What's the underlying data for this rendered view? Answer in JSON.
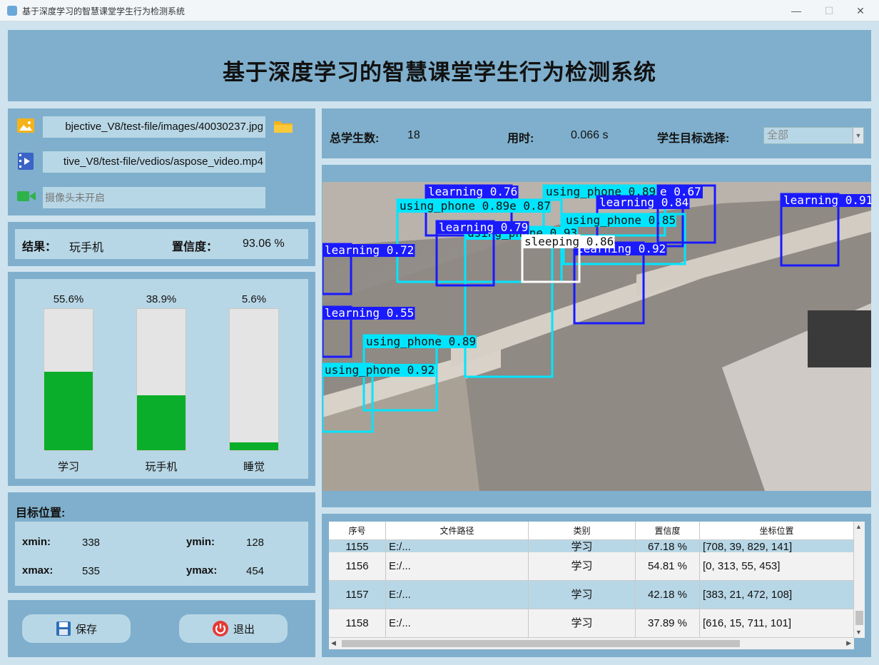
{
  "window": {
    "title": "基于深度学习的智慧课堂学生行为检测系统",
    "minimize": "—",
    "maximize": "☐",
    "close": "✕"
  },
  "header": {
    "title": "基于深度学习的智慧课堂学生行为检测系统"
  },
  "inputs": {
    "image_path": "bjective_V8/test-file/images/40030237.jpg",
    "video_path": "tive_V8/test-file/vedios/aspose_video.mp4",
    "camera_placeholder": "摄像头未开启"
  },
  "result": {
    "result_label": "结果：",
    "result_value": "玩手机",
    "confidence_label": "置信度：",
    "confidence_value": "93.06 %"
  },
  "stats": {
    "total_label": "总学生数:",
    "total_value": "18",
    "time_label": "用时:",
    "time_value": "0.066 s",
    "target_label": "学生目标选择:",
    "target_value": "全部"
  },
  "chart_data": {
    "type": "bar",
    "categories": [
      "学习",
      "玩手机",
      "睡觉"
    ],
    "values": [
      55.6,
      38.9,
      5.6
    ],
    "value_labels": [
      "55.6%",
      "38.9%",
      "5.6%"
    ],
    "ylim": [
      0,
      100
    ],
    "colors": {
      "fill": "#0aae2a",
      "track": "#e4e4e4"
    }
  },
  "position": {
    "title": "目标位置:",
    "xmin_label": "xmin:",
    "xmin": "338",
    "ymin_label": "ymin:",
    "ymin": "128",
    "xmax_label": "xmax:",
    "xmax": "535",
    "ymax_label": "ymax:",
    "ymax": "454"
  },
  "buttons": {
    "save": "保存",
    "exit": "退出"
  },
  "detections": [
    {
      "label": "learning 0.76"
    },
    {
      "label": "using_phone 0.89"
    },
    {
      "label": "using_phone 0.89e 0.87"
    },
    {
      "label": "learning 0.84"
    },
    {
      "label": "learning 0.91"
    },
    {
      "label": "using_phone 0.85"
    },
    {
      "label": "using_phone 0.93"
    },
    {
      "label": "learning 0.72"
    },
    {
      "label": "learning 0.92"
    },
    {
      "label": "sleeping 0.86"
    },
    {
      "label": "learning 0.55"
    },
    {
      "label": "using_phone 0.89"
    },
    {
      "label": "using_phone 0.92"
    },
    {
      "label": "learning 0.79"
    },
    {
      "label": "e 0.67"
    }
  ],
  "table": {
    "headers": [
      "序号",
      "文件路径",
      "类别",
      "置信度",
      "坐标位置"
    ],
    "partial_row": [
      "1155",
      "E:/...",
      "学习",
      "67.18 %",
      "[708, 39, 829, 141]"
    ],
    "rows": [
      [
        "1156",
        "E:/...",
        "学习",
        "54.81 %",
        "[0, 313, 55, 453]"
      ],
      [
        "1157",
        "E:/...",
        "学习",
        "42.18 %",
        "[383, 21, 472, 108]"
      ],
      [
        "1158",
        "E:/...",
        "学习",
        "37.89 %",
        "[616, 15, 711, 101]"
      ]
    ]
  },
  "colors": {
    "panel": "#7fafcc",
    "inner": "#b8d7e6",
    "learning": "#1a1aff",
    "phone": "#00e5ff",
    "sleeping": "#ffffff"
  }
}
